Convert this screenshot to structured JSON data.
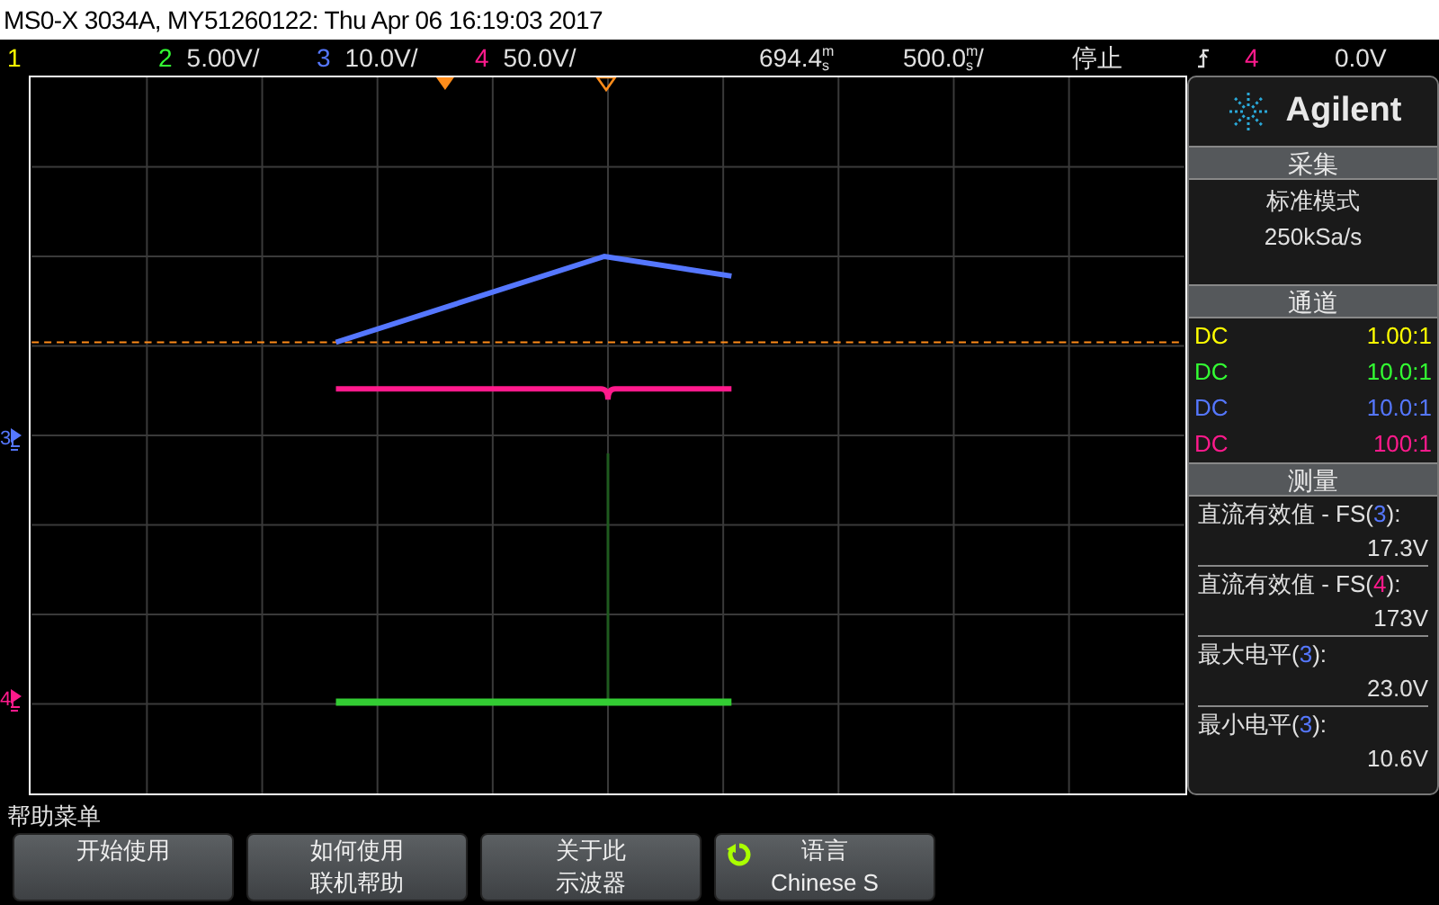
{
  "title": "MS0-X 3034A, MY51260122: Thu Apr 06 16:19:03 2017",
  "status_bar": {
    "channels": [
      {
        "number": "1",
        "color": "#ffff00"
      },
      {
        "number": "2",
        "scale": "5.00V/",
        "color": "#33ff33"
      },
      {
        "number": "3",
        "scale": "10.0V/",
        "color": "#5577ff"
      },
      {
        "number": "4",
        "scale": "50.0V/",
        "color": "#ff1a8c"
      }
    ],
    "delay": {
      "value": "694.4",
      "unit": "ms"
    },
    "timebase": {
      "value": "500.0",
      "unit": "ms",
      "suffix": "/"
    },
    "run_state": "停止",
    "trigger": {
      "source": "4",
      "color": "#ff1a8c",
      "level": "0.0V"
    }
  },
  "ground_markers": [
    {
      "label": "3",
      "color": "#5577ff"
    },
    {
      "label": "4",
      "color": "#ff1a8c"
    }
  ],
  "panel": {
    "brand": "Agilent",
    "acquisition": {
      "title": "采集",
      "lines": [
        "标准模式",
        "250kSa/s"
      ]
    },
    "channels": {
      "title": "通道",
      "rows": [
        {
          "coupling": "DC",
          "ratio": "1.00:1",
          "color": "#ffff00"
        },
        {
          "coupling": "DC",
          "ratio": "10.0:1",
          "color": "#33ff33"
        },
        {
          "coupling": "DC",
          "ratio": "10.0:1",
          "color": "#5577ff"
        },
        {
          "coupling": "DC",
          "ratio": "100:1",
          "color": "#ff1a8c"
        }
      ]
    },
    "measurements": {
      "title": "测量",
      "items": [
        {
          "prefix": "直流有效值 - FS(",
          "source": "3",
          "suffix": "):",
          "color": "#5577ff",
          "value": "17.3V"
        },
        {
          "prefix": "直流有效值 - FS(",
          "source": "4",
          "suffix": "):",
          "color": "#ff1a8c",
          "value": "173V"
        },
        {
          "prefix": "最大电平(",
          "source": "3",
          "suffix": "):",
          "color": "#5577ff",
          "value": "23.0V"
        },
        {
          "prefix": "最小电平(",
          "source": "3",
          "suffix": "):",
          "color": "#5577ff",
          "value": "10.6V"
        }
      ]
    }
  },
  "menu": {
    "title": "帮助菜单",
    "softkeys": [
      {
        "kind": "plain",
        "lines": [
          "开始使用"
        ]
      },
      {
        "kind": "plain",
        "lines": [
          "如何使用",
          "联机帮助"
        ]
      },
      {
        "kind": "plain",
        "lines": [
          "关于此",
          "示波器"
        ]
      },
      {
        "kind": "rotary",
        "lines": [
          "语言",
          "Chinese S"
        ]
      }
    ]
  }
}
